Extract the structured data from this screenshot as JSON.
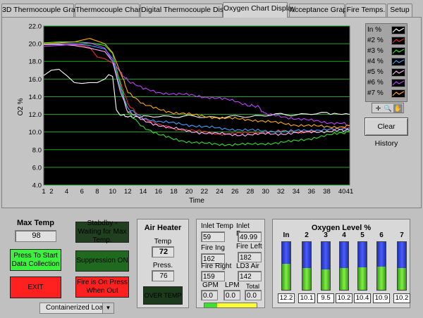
{
  "tabs": [
    {
      "label": "3D Thermocouple Graph",
      "active": false
    },
    {
      "label": "Thermocouple Chart",
      "active": false
    },
    {
      "label": "Digital Thermocouple Display",
      "active": false
    },
    {
      "label": "Oxygen Chart Display",
      "active": true
    },
    {
      "label": "Acceptance Graph",
      "active": false
    },
    {
      "label": "Fire Temps.",
      "active": false
    },
    {
      "label": "Setup",
      "active": false
    }
  ],
  "chart": {
    "ylabel": "O2 %",
    "xlabel": "Time",
    "clear_history_label": "Clear History",
    "legend": [
      {
        "name": "In %",
        "color": "#ffffff"
      },
      {
        "name": "#2 %",
        "color": "#e03030"
      },
      {
        "name": "#3 %",
        "color": "#30e030"
      },
      {
        "name": "#4 %",
        "color": "#40a0ff"
      },
      {
        "name": "#5 %",
        "color": "#ffb0ff"
      },
      {
        "name": "#6 %",
        "color": "#c040ff"
      },
      {
        "name": "#7 %",
        "color": "#ffb000"
      }
    ]
  },
  "chart_data": {
    "type": "line",
    "xlabel": "Time",
    "ylabel": "O2 %",
    "xlim": [
      1,
      41
    ],
    "ylim": [
      4.0,
      22.0
    ],
    "x_ticks": [
      "1",
      "2",
      "4",
      "6",
      "8",
      "10",
      "12",
      "14",
      "16",
      "18",
      "20",
      "22",
      "24",
      "26",
      "28",
      "30",
      "32",
      "34",
      "36",
      "38",
      "40",
      "41"
    ],
    "y_ticks": [
      "4.0",
      "6.0",
      "8.0",
      "10.0",
      "12.0",
      "14.0",
      "16.0",
      "18.0",
      "20.0",
      "22.0"
    ],
    "grid": true,
    "legend_placement": "right",
    "series": [
      {
        "name": "In %",
        "color": "#ffffff",
        "x": [
          1,
          2,
          3,
          4,
          5,
          6,
          7,
          8,
          9,
          9.5,
          10,
          10.5,
          11,
          12,
          14,
          18,
          22,
          26,
          30,
          34,
          38,
          41
        ],
        "y": [
          16.4,
          17.0,
          17.1,
          16.4,
          15.6,
          15.5,
          15.6,
          15.6,
          16.0,
          16.5,
          16.3,
          12.5,
          11.9,
          11.8,
          11.7,
          11.8,
          11.7,
          11.7,
          11.9,
          12.0,
          12.1,
          12.0
        ]
      },
      {
        "name": "#2 %",
        "color": "#e03030",
        "x": [
          1,
          3,
          5,
          6,
          7,
          8,
          9,
          10,
          11,
          12,
          14,
          16,
          18,
          20,
          22,
          24,
          26,
          28,
          30,
          32,
          34,
          36,
          38,
          40,
          41
        ],
        "y": [
          20.0,
          20.0,
          19.9,
          19.8,
          19.6,
          18.5,
          18.3,
          17.8,
          15.8,
          13.2,
          11.5,
          10.8,
          10.4,
          10.2,
          10.0,
          9.8,
          9.8,
          9.9,
          10.0,
          10.1,
          10.0,
          10.1,
          10.2,
          10.4,
          10.5
        ]
      },
      {
        "name": "#3 %",
        "color": "#30e030",
        "x": [
          1,
          3,
          5,
          7,
          9,
          10,
          11,
          12,
          14,
          16,
          18,
          20,
          22,
          24,
          26,
          28,
          30,
          32,
          34,
          36,
          38,
          40,
          41
        ],
        "y": [
          20.1,
          20.2,
          20.2,
          20.1,
          19.8,
          18.9,
          15.5,
          12.2,
          10.6,
          9.7,
          9.2,
          8.9,
          8.7,
          8.6,
          8.6,
          8.6,
          8.7,
          8.8,
          9.0,
          9.3,
          9.6,
          9.9,
          10.0
        ]
      },
      {
        "name": "#4 %",
        "color": "#40a0ff",
        "x": [
          1,
          3,
          5,
          7,
          9,
          10,
          11,
          12,
          14,
          16,
          18,
          20,
          22,
          24,
          26,
          28,
          30,
          32,
          34,
          36,
          38,
          40,
          41
        ],
        "y": [
          20.0,
          20.0,
          20.0,
          19.8,
          19.4,
          18.3,
          15.0,
          12.6,
          11.6,
          11.2,
          11.0,
          10.8,
          10.6,
          10.4,
          10.3,
          10.2,
          10.1,
          10.1,
          10.1,
          10.2,
          10.3,
          10.3,
          10.4
        ]
      },
      {
        "name": "#5 %",
        "color": "#ffb0ff",
        "x": [
          1,
          3,
          5,
          7,
          9,
          10,
          11,
          12,
          14,
          16,
          18,
          20,
          22,
          24,
          26,
          28,
          30,
          32,
          34,
          36,
          38,
          40,
          41
        ],
        "y": [
          19.9,
          19.9,
          19.8,
          19.5,
          19.1,
          18.0,
          14.6,
          12.3,
          11.3,
          10.8,
          10.4,
          10.1,
          9.9,
          9.8,
          9.7,
          9.7,
          9.8,
          9.8,
          9.9,
          10.0,
          10.1,
          10.2,
          10.2
        ]
      },
      {
        "name": "#6 %",
        "color": "#c040ff",
        "x": [
          1,
          3,
          5,
          7,
          9,
          10,
          11,
          12,
          14,
          16,
          18,
          20,
          22,
          24,
          26,
          28,
          29,
          30,
          32,
          34,
          36,
          38,
          40,
          41
        ],
        "y": [
          19.7,
          19.8,
          19.9,
          20.1,
          19.5,
          18.0,
          16.8,
          15.8,
          14.9,
          14.5,
          14.3,
          14.2,
          14.0,
          13.8,
          13.5,
          13.0,
          12.9,
          12.0,
          11.8,
          11.5,
          11.3,
          11.1,
          11.0,
          10.8
        ]
      },
      {
        "name": "#7 %",
        "color": "#ffb000",
        "x": [
          1,
          3,
          5,
          7,
          8,
          9,
          10,
          11,
          12,
          14,
          16,
          18,
          20,
          22,
          24,
          26,
          28,
          30,
          32,
          34,
          36,
          38,
          40,
          41
        ],
        "y": [
          20.0,
          20.1,
          20.2,
          20.6,
          20.3,
          20.0,
          19.0,
          16.8,
          14.6,
          13.1,
          12.6,
          12.2,
          12.0,
          11.8,
          11.6,
          11.5,
          11.4,
          11.2,
          11.0,
          10.8,
          10.7,
          10.6,
          10.6,
          10.7
        ]
      }
    ]
  },
  "controls": {
    "max_temp_label": "Max Temp",
    "max_temp_value": "98",
    "standby_label": "Stabdby - Waiting for Max Temp.",
    "start_label": "Press To Start Data Collection",
    "suppression_label": "Suppression ON",
    "exit_label": "EXIT",
    "fire_label": "Fire is On Press When Out",
    "load_select": "Containerized Load"
  },
  "air_heater": {
    "title": "Air Heater",
    "temp_label": "Temp",
    "temp_value": "72",
    "press_label": "Press.",
    "press_value": "76",
    "over_temp_label": "OVER TEMP"
  },
  "readings": {
    "inlet_temp_label": "Inlet Temp",
    "inlet_temp_value": "59",
    "inlet_pres_label": "Inlet Pres.",
    "inlet_pres_value": "49.99",
    "fire_ing_label": "Fire Ing",
    "fire_ing_value": "162",
    "fire_left_label": "Fire Left",
    "fire_left_value": "182",
    "fire_right_label": "Fire Right",
    "fire_right_value": "159",
    "ld3_air_label": "LD3 Air",
    "ld3_air_value": "142",
    "gpm_label": "GPM",
    "gpm_value": "0.0",
    "lpm_label": "LPM",
    "lpm_value": "0.0",
    "total_label": "Total L",
    "total_value": "0.0"
  },
  "oxygen": {
    "title": "Oxygen Level %",
    "tanks": [
      {
        "label": "In",
        "value": "12.2",
        "level": 0.55
      },
      {
        "label": "2",
        "value": "10.1",
        "level": 0.46
      },
      {
        "label": "3",
        "value": "9.5",
        "level": 0.43
      },
      {
        "label": "4",
        "value": "10.2",
        "level": 0.46
      },
      {
        "label": "5",
        "value": "10.4",
        "level": 0.47
      },
      {
        "label": "6",
        "value": "10.9",
        "level": 0.49
      },
      {
        "label": "7",
        "value": "10.2",
        "level": 0.46
      }
    ]
  }
}
